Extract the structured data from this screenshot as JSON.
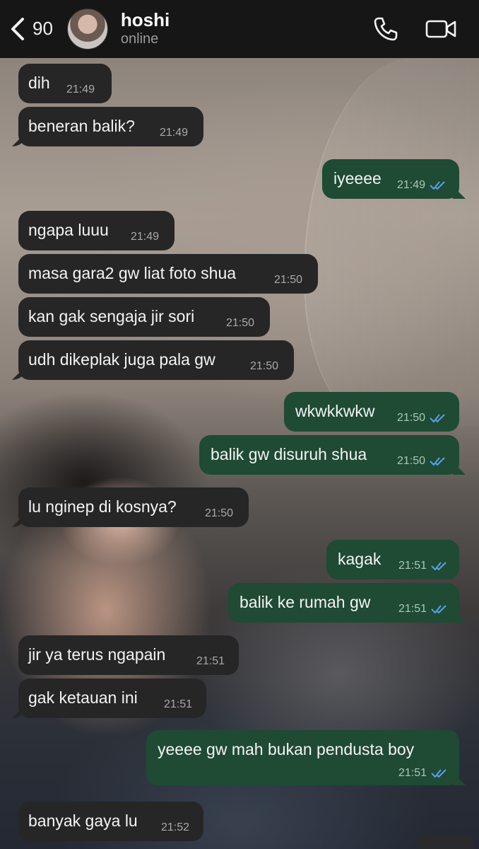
{
  "header": {
    "back_count": "90",
    "contact_name": "hoshi",
    "contact_status": "online"
  },
  "messages": [
    {
      "dir": "in",
      "text": "dih",
      "time": "21:49"
    },
    {
      "dir": "in",
      "text": "beneran balik?",
      "time": "21:49"
    },
    {
      "dir": "out",
      "text": "iyeeee",
      "time": "21:49",
      "read": true
    },
    {
      "dir": "in",
      "text": "ngapa luuu",
      "time": "21:49"
    },
    {
      "dir": "in",
      "text": "masa gara2 gw liat foto shua",
      "time": "21:50"
    },
    {
      "dir": "in",
      "text": "kan gak sengaja jir sori",
      "time": "21:50"
    },
    {
      "dir": "in",
      "text": "udh dikeplak juga pala gw",
      "time": "21:50"
    },
    {
      "dir": "out",
      "text": "wkwkkwkw",
      "time": "21:50",
      "read": true
    },
    {
      "dir": "out",
      "text": "balik gw disuruh shua",
      "time": "21:50",
      "read": true
    },
    {
      "dir": "in",
      "text": "lu nginep di kosnya?",
      "time": "21:50"
    },
    {
      "dir": "out",
      "text": "kagak",
      "time": "21:51",
      "read": true
    },
    {
      "dir": "out",
      "text": "balik ke rumah gw",
      "time": "21:51",
      "read": true
    },
    {
      "dir": "in",
      "text": "jir ya terus ngapain",
      "time": "21:51"
    },
    {
      "dir": "in",
      "text": "gak ketauan ini",
      "time": "21:51"
    },
    {
      "dir": "out",
      "text": "yeeee gw mah bukan pendusta boy",
      "time": "21:51",
      "read": true
    },
    {
      "dir": "in",
      "text": "banyak gaya lu",
      "time": "21:52"
    }
  ],
  "colors": {
    "incoming_bubble": "#262626",
    "outgoing_bubble": "#1f4a34",
    "read_tick": "#5aa2e6"
  },
  "icons": [
    "chevron-left-icon",
    "phone-icon",
    "video-camera-icon",
    "double-check-icon"
  ]
}
